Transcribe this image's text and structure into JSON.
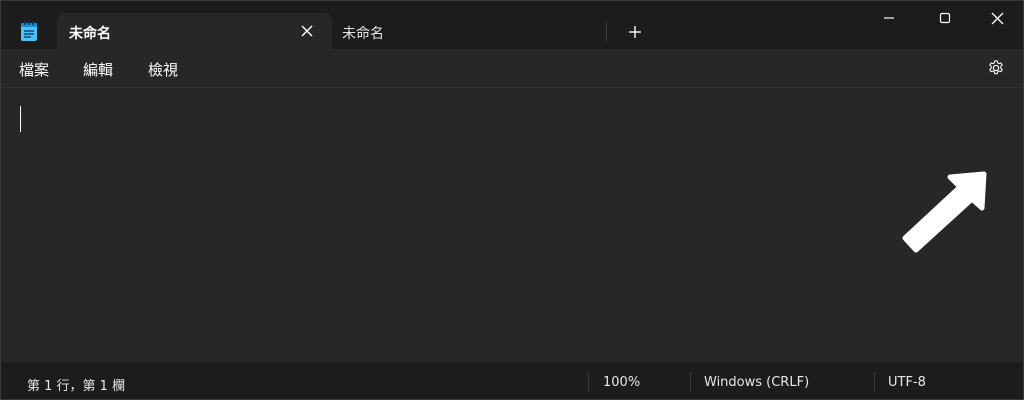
{
  "tabs": [
    {
      "label": "未命名",
      "active": true
    },
    {
      "label": "未命名",
      "active": false
    }
  ],
  "menu": {
    "file": "檔案",
    "edit": "編輯",
    "view": "檢視"
  },
  "status": {
    "position": "第 1 行，第 1 欄",
    "zoom": "100%",
    "line_ending": "Windows (CRLF)",
    "encoding": "UTF-8"
  },
  "icons": {
    "app": "notepad-icon",
    "tab_close": "close-icon",
    "new_tab": "plus-icon",
    "minimize": "minimize-icon",
    "maximize": "maximize-icon",
    "close": "close-icon",
    "settings": "gear-icon",
    "annotation": "arrow-icon"
  },
  "colors": {
    "titlebar": "#1c1c1c",
    "active_tab": "#272727",
    "editor": "#272727",
    "statusbar": "#1c1c1c",
    "accent_icon": "#4cc2ff",
    "arrow": "#ffffff"
  }
}
